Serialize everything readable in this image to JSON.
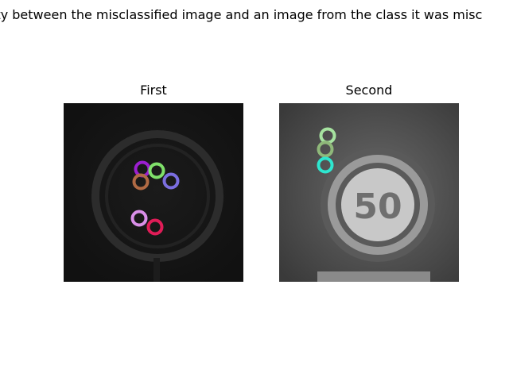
{
  "figure": {
    "title": "ity between the misclassified image and an image from the class it was misc"
  },
  "panels": [
    {
      "title": "First",
      "keypoint_colors": [
        "#9c1fd0",
        "#7fe06a",
        "#b06a44",
        "#7b6ee0",
        "#d98fe8",
        "#e01c57"
      ]
    },
    {
      "title": "Second",
      "keypoint_colors": [
        "#a6e3a0",
        "#8fb87a",
        "#2ee6cf"
      ]
    }
  ]
}
